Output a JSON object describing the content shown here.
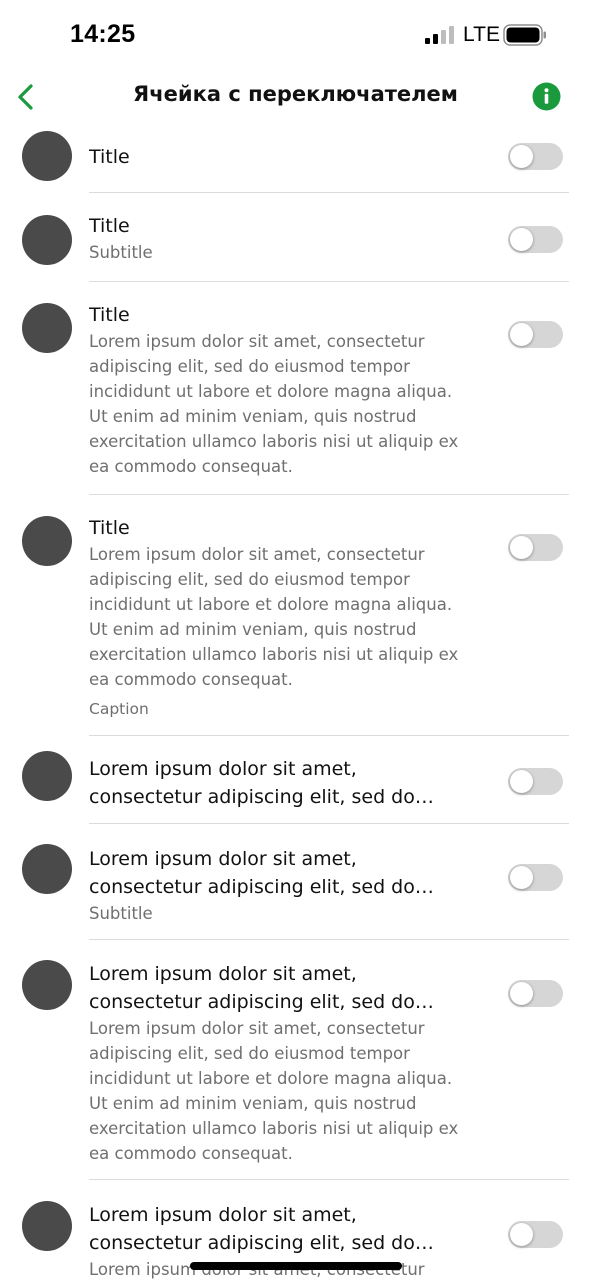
{
  "status_bar": {
    "time": "14:25",
    "network": "LTE",
    "icons": [
      "signal-icon",
      "battery-icon"
    ]
  },
  "nav": {
    "title": "Ячейка с переключателем",
    "back_icon": "chevron-left-icon",
    "info_icon": "info-icon",
    "accent_color": "#1a9a3c"
  },
  "cells": [
    {
      "title": "Title",
      "toggle_on": false
    },
    {
      "title": "Title",
      "subtitle": "Subtitle",
      "toggle_on": false
    },
    {
      "title": "Title",
      "body": "Lorem ipsum dolor sit amet, consectetur adipiscing elit, sed do eiusmod tempor incididunt ut labore et dolore magna aliqua. Ut enim ad minim veniam, quis nostrud exercitation ullamco laboris nisi ut aliquip ex ea commodo consequat.",
      "toggle_on": false
    },
    {
      "title": "Title",
      "body": "Lorem ipsum dolor sit amet, consectetur adipiscing elit, sed do eiusmod tempor incididunt ut labore et dolore magna aliqua. Ut enim ad minim veniam, quis nostrud exercitation ullamco laboris nisi ut aliquip ex ea commodo consequat.",
      "caption": "Caption",
      "toggle_on": false
    },
    {
      "title": "Lorem ipsum dolor sit amet, consectetur adipiscing elit, sed do…",
      "toggle_on": false
    },
    {
      "title": "Lorem ipsum dolor sit amet, consectetur adipiscing elit, sed do…",
      "subtitle": "Subtitle",
      "toggle_on": false
    },
    {
      "title": "Lorem ipsum dolor sit amet, consectetur adipiscing elit, sed do…",
      "body": "Lorem ipsum dolor sit amet, consectetur adipiscing elit, sed do eiusmod tempor incididunt ut labore et dolore magna aliqua. Ut enim ad minim veniam, quis nostrud exercitation ullamco laboris nisi ut aliquip ex ea commodo consequat.",
      "toggle_on": false
    },
    {
      "title": "Lorem ipsum dolor sit amet, consectetur adipiscing elit, sed do…",
      "body": "Lorem ipsum dolor sit amet, consectetur",
      "toggle_on": false
    }
  ]
}
